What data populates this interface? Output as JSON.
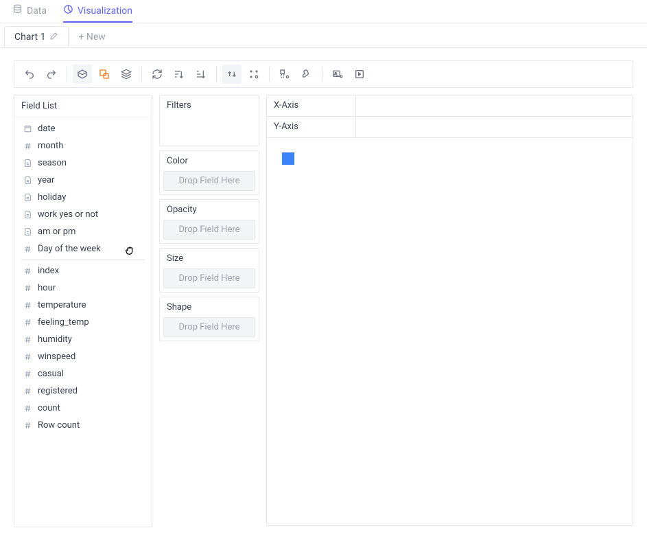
{
  "tabs": {
    "data": "Data",
    "visualization": "Visualization"
  },
  "chartTabs": {
    "current": "Chart 1",
    "new": "+ New"
  },
  "fieldList": {
    "title": "Field List",
    "group1": [
      {
        "name": "date",
        "icon": "date"
      },
      {
        "name": "month",
        "icon": "hash"
      },
      {
        "name": "season",
        "icon": "text"
      },
      {
        "name": "year",
        "icon": "text"
      },
      {
        "name": "holiday",
        "icon": "text"
      },
      {
        "name": "work yes or not",
        "icon": "text"
      },
      {
        "name": "am or pm",
        "icon": "text"
      },
      {
        "name": "Day of the week",
        "icon": "hash"
      }
    ],
    "group2": [
      {
        "name": "index",
        "icon": "hash"
      },
      {
        "name": "hour",
        "icon": "hash"
      },
      {
        "name": "temperature",
        "icon": "hash"
      },
      {
        "name": "feeling_temp",
        "icon": "hash"
      },
      {
        "name": "humidity",
        "icon": "hash"
      },
      {
        "name": "winspeed",
        "icon": "hash"
      },
      {
        "name": "casual",
        "icon": "hash"
      },
      {
        "name": "registered",
        "icon": "hash"
      },
      {
        "name": "count",
        "icon": "hash"
      },
      {
        "name": "Row count",
        "icon": "hash"
      }
    ]
  },
  "encodings": {
    "filters": {
      "title": "Filters"
    },
    "color": {
      "title": "Color",
      "placeholder": "Drop Field Here"
    },
    "opacity": {
      "title": "Opacity",
      "placeholder": "Drop Field Here"
    },
    "size": {
      "title": "Size",
      "placeholder": "Drop Field Here"
    },
    "shape": {
      "title": "Shape",
      "placeholder": "Drop Field Here"
    }
  },
  "axes": {
    "x": "X-Axis",
    "y": "Y-Axis"
  },
  "canvas": {
    "markColor": "#3b82f6"
  }
}
